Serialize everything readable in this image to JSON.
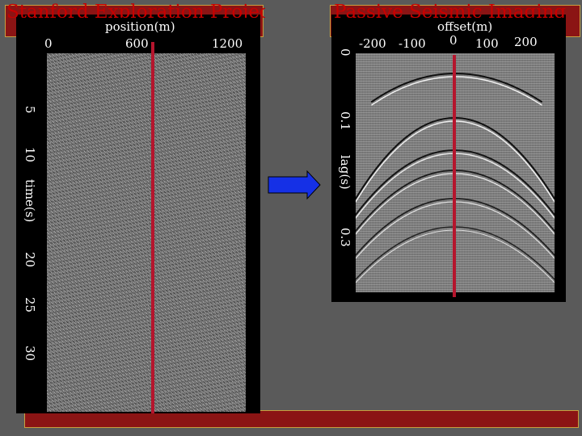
{
  "banners": {
    "left_title": "Stanford Exploration Project",
    "right_title": "Passive Seismic Imaging"
  },
  "left_panel": {
    "x_label": "position(m)",
    "x_ticks": [
      "0",
      "600",
      "1200"
    ],
    "y_label": "time(s)",
    "y_ticks": [
      "5",
      "10",
      "20",
      "25",
      "30"
    ]
  },
  "right_panel": {
    "x_label": "offset(m)",
    "x_ticks": [
      "-200",
      "-100",
      "0",
      "100",
      "200"
    ],
    "y_label": "lag(s)",
    "y_ticks": [
      "0",
      "0.1",
      "0.3"
    ]
  },
  "colors": {
    "background": "#5a5a5a",
    "banner": "#8b1414",
    "title_text": "#c80000",
    "marker_line": "#b5152d",
    "arrow_fill": "#1530e6"
  },
  "icons": {
    "arrow": "right-arrow-icon"
  }
}
